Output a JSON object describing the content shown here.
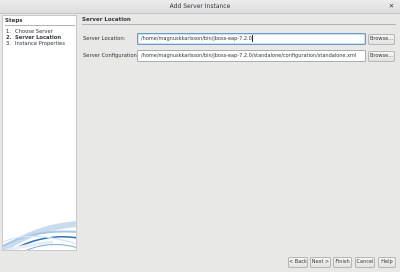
{
  "window": {
    "title": "Add Server Instance",
    "close_glyph": "✕"
  },
  "steps": {
    "title": "Steps",
    "items": [
      {
        "num": "1.",
        "label": "Choose Server"
      },
      {
        "num": "2.",
        "label": "Server Location"
      },
      {
        "num": "3.",
        "label": "Instance Properties"
      }
    ]
  },
  "main": {
    "section_title": "Server Location",
    "server_location": {
      "label": "Server Location:",
      "value": "/home/magnuskkarlsson/bin/jboss-eap-7.2.0",
      "browse": "Browse..."
    },
    "server_configuration": {
      "label": "Server Configuration:",
      "value": "/home/magnuskkarlsson/bin/jboss-eap-7.2.0/standalone/configuration/standalone.xml",
      "browse": "Browse..."
    }
  },
  "buttons": {
    "back": "< Back",
    "next": "Next >",
    "finish": "Finish",
    "cancel": "Cancel",
    "help": "Help"
  },
  "colors": {
    "background": "#e8e8e7",
    "panel": "#ffffff",
    "focus_border": "#6a9acb",
    "swoosh": "#2c72b8"
  },
  "icons": {
    "close": "close-icon",
    "swoosh": "wizard-swoosh-graphic"
  }
}
